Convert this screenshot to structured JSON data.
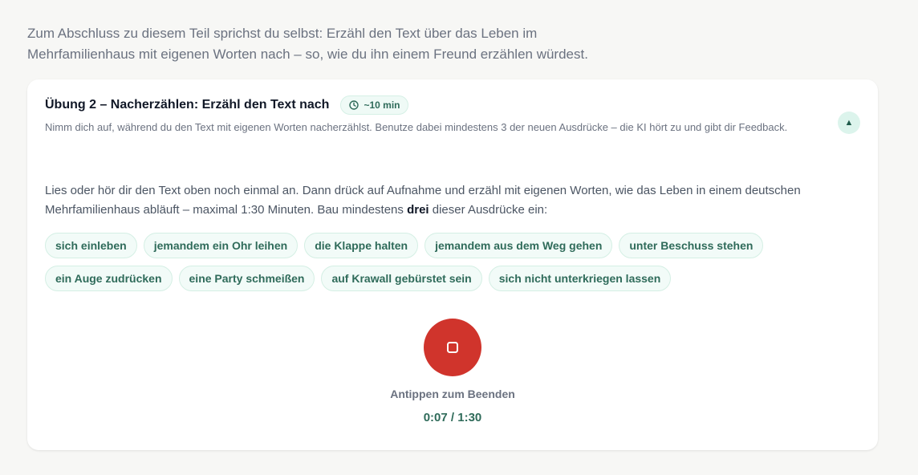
{
  "intro": {
    "line1": "Zum Abschluss zu diesem Teil sprichst du selbst: Erzähl den Text über das Leben im",
    "line2": "Mehrfamilienhaus mit eigenen Worten nach – so, wie du ihn einem Freund erzählen würdest."
  },
  "exercise": {
    "title": "Übung 2 – Nacherzählen: Erzähl den Text nach",
    "duration": "~10 min",
    "duration_icon": "clock-icon",
    "subtitle": "Nimm dich auf, während du den Text mit eigenen Worten nacherzählst. Benutze dabei mindestens 3 der neuen Ausdrücke – die KI hört zu und gibt dir Feedback.",
    "collapse_icon": "▲",
    "instruction_before": "Lies oder hör dir den Text oben noch einmal an. Dann drück auf Aufnahme und erzähl mit eigenen Worten, wie das Leben in einem deutschen Mehrfamilienhaus abläuft – maximal 1:30 Minuten. Bau mindestens ",
    "instruction_bold": "drei",
    "instruction_after": " dieser Ausdrücke ein:",
    "expressions": [
      "sich einleben",
      "jemandem ein Ohr leihen",
      "die Klappe halten",
      "jemandem aus dem Weg gehen",
      "unter Beschuss stehen",
      "ein Auge zudrücken",
      "eine Party schmeißen",
      "auf Krawall gebürstet sein",
      "sich nicht unterkriegen lassen"
    ],
    "recorder": {
      "button_icon": "stop-icon",
      "hint": "Antippen zum Beenden",
      "elapsed": "0:07",
      "separator": " / ",
      "limit": "1:30"
    }
  },
  "colors": {
    "accent": "#2f6b5a",
    "record": "#d0342c",
    "chip_bg": "#f2fbf8"
  }
}
